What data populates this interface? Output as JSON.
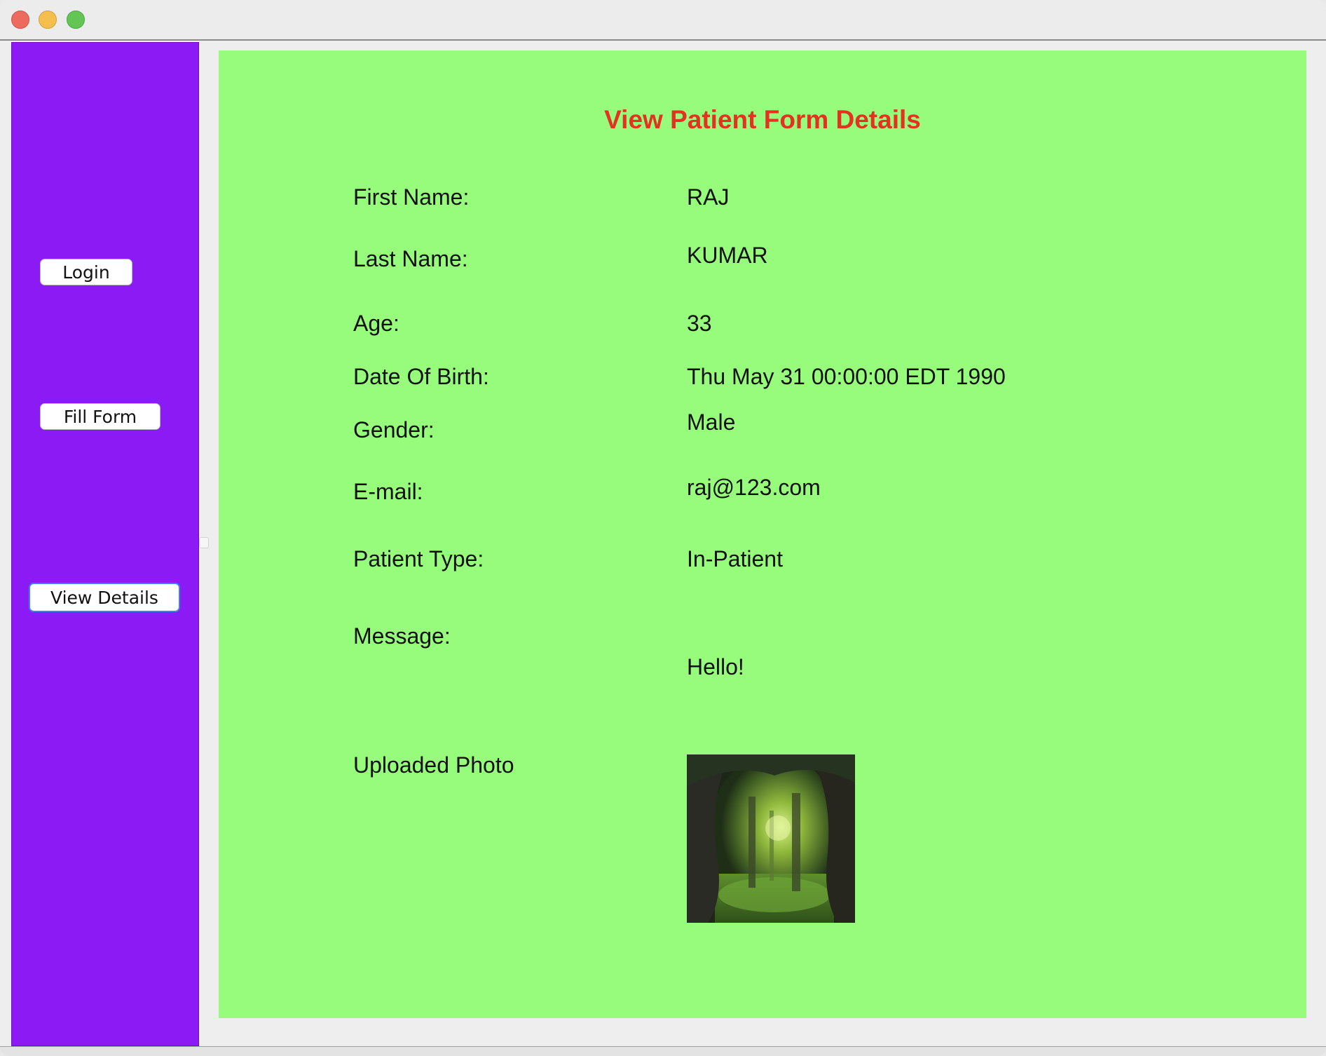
{
  "window": {
    "title": ""
  },
  "sidebar": {
    "buttons": [
      {
        "label": "Login"
      },
      {
        "label": "Fill Form"
      },
      {
        "label": "View Details"
      }
    ]
  },
  "form": {
    "title": "View Patient Form Details",
    "fields": [
      {
        "label": "First Name:",
        "value": "RAJ"
      },
      {
        "label": "Last Name:",
        "value": "KUMAR"
      },
      {
        "label": "Age:",
        "value": "33"
      },
      {
        "label": "Date Of Birth:",
        "value": "Thu May 31 00:00:00 EDT 1990"
      },
      {
        "label": "Gender:",
        "value": "Male"
      },
      {
        "label": "E-mail:",
        "value": "raj@123.com"
      },
      {
        "label": "Patient Type:",
        "value": "In-Patient"
      },
      {
        "label": "Message:",
        "value": "Hello!"
      }
    ],
    "photo_label": "Uploaded Photo"
  },
  "colors": {
    "sidebar_bg": "#8c1af5",
    "content_bg": "#97fb7b",
    "title_color": "#e3321f"
  }
}
